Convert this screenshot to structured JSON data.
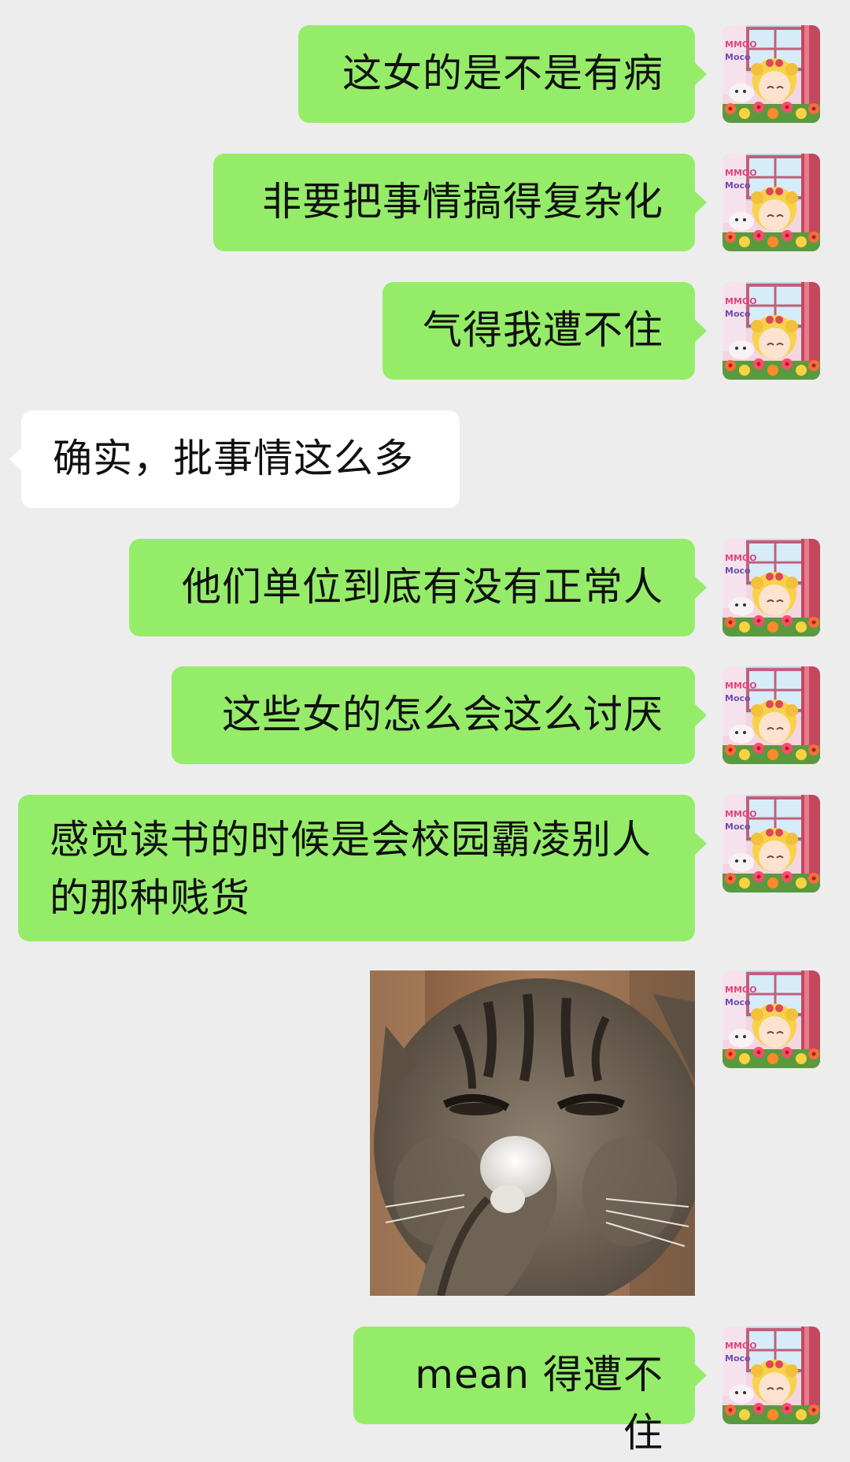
{
  "messages": [
    {
      "side": "me",
      "text": "这女的是不是有病"
    },
    {
      "side": "me",
      "text": "非要把事情搞得复杂化"
    },
    {
      "side": "me",
      "text": "气得我遭不住"
    },
    {
      "side": "them",
      "text": "确实，批事情这么多"
    },
    {
      "side": "me",
      "text": "他们单位到底有没有正常人"
    },
    {
      "side": "me",
      "text": "这些女的怎么会这么讨厌"
    },
    {
      "side": "me",
      "text": "感觉读书的时候是会校园霸凌别人的那种贱货"
    },
    {
      "side": "me",
      "type": "sticker",
      "sticker": "cat-covering-nose-sticker"
    },
    {
      "side": "me",
      "text": "mean 得遭不住"
    }
  ],
  "avatar": {
    "text": "MMOO Moco"
  },
  "colors": {
    "background": "#ededed",
    "my_bubble": "#95ec69",
    "their_bubble": "#ffffff",
    "text": "#111111"
  }
}
